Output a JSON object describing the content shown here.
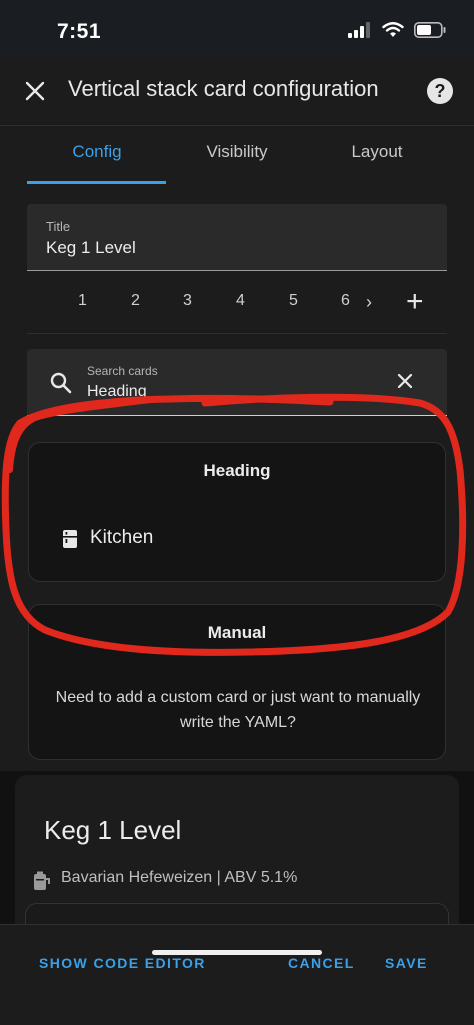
{
  "status_bar": {
    "time": "7:51"
  },
  "dialog": {
    "title": "Vertical stack card configuration",
    "help_label": "?"
  },
  "tabs": [
    {
      "label": "Config",
      "active": true
    },
    {
      "label": "Visibility",
      "active": false
    },
    {
      "label": "Layout",
      "active": false
    }
  ],
  "title_field": {
    "label": "Title",
    "value": "Keg 1 Level"
  },
  "card_tabs": [
    "1",
    "2",
    "3",
    "4",
    "5",
    "6"
  ],
  "search": {
    "label": "Search cards",
    "value": "Heading"
  },
  "result_card": {
    "title": "Heading",
    "entity": "Kitchen"
  },
  "manual_card": {
    "title": "Manual",
    "description": "Need to add a custom card or just want to manually write the YAML?"
  },
  "preview": {
    "title": "Keg 1 Level",
    "subtitle": "Bavarian Hefeweizen | ABV 5.1%"
  },
  "footer": {
    "code_editor": "SHOW CODE EDITOR",
    "cancel": "CANCEL",
    "save": "SAVE"
  },
  "colors": {
    "accent": "#3aa0e8",
    "annotation": "#e0281c"
  }
}
